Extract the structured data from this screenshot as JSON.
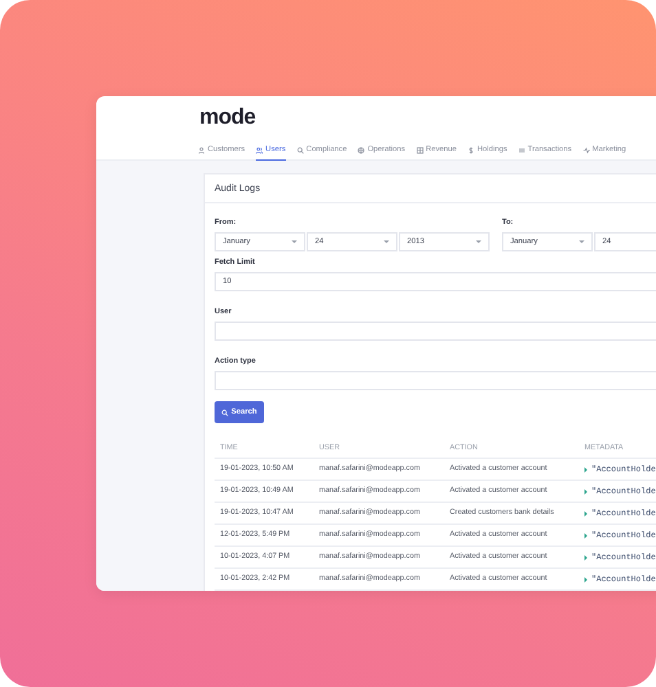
{
  "logo": "mode",
  "nav": [
    {
      "label": "Customers",
      "selected": false
    },
    {
      "label": "Users",
      "selected": true
    },
    {
      "label": "Compliance",
      "selected": false
    },
    {
      "label": "Operations",
      "selected": false
    },
    {
      "label": "Revenue",
      "selected": false
    },
    {
      "label": "Holdings",
      "selected": false
    },
    {
      "label": "Transactions",
      "selected": false
    },
    {
      "label": "Marketing",
      "selected": false
    }
  ],
  "card_title": "Audit Logs",
  "from": {
    "label": "From:",
    "selects": [
      "January",
      "24",
      "2013"
    ]
  },
  "to": {
    "label": "To:",
    "selects": [
      "January",
      "24"
    ]
  },
  "fields": [
    {
      "label": "Fetch Limit",
      "value": "10"
    },
    {
      "label": "User"
    },
    {
      "label": "Action type"
    }
  ],
  "search_button": "Search",
  "table": {
    "columns": [
      "TIME",
      "USER",
      "ACTION",
      "METADATA"
    ],
    "rows": [
      {
        "time": "19-01-2023, 10:50 AM",
        "user": "manaf.safarini@modeapp.com",
        "action": "Activated a customer account",
        "metadata": "\"AccountHolde"
      },
      {
        "time": "19-01-2023, 10:49 AM",
        "user": "manaf.safarini@modeapp.com",
        "action": "Activated a customer account",
        "metadata": "\"AccountHolde"
      },
      {
        "time": "19-01-2023, 10:47 AM",
        "user": "manaf.safarini@modeapp.com",
        "action": "Created customers bank details",
        "metadata": "\"AccountHolde"
      },
      {
        "time": "12-01-2023, 5:49 PM",
        "user": "manaf.safarini@modeapp.com",
        "action": "Activated a customer account",
        "metadata": "\"AccountHolde"
      },
      {
        "time": "10-01-2023, 4:07 PM",
        "user": "manaf.safarini@modeapp.com",
        "action": "Activated a customer account",
        "metadata": "\"AccountHolde"
      },
      {
        "time": "10-01-2023, 2:42 PM",
        "user": "manaf.safarini@modeapp.com",
        "action": "Activated a customer account",
        "metadata": "\"AccountHolde"
      }
    ]
  }
}
